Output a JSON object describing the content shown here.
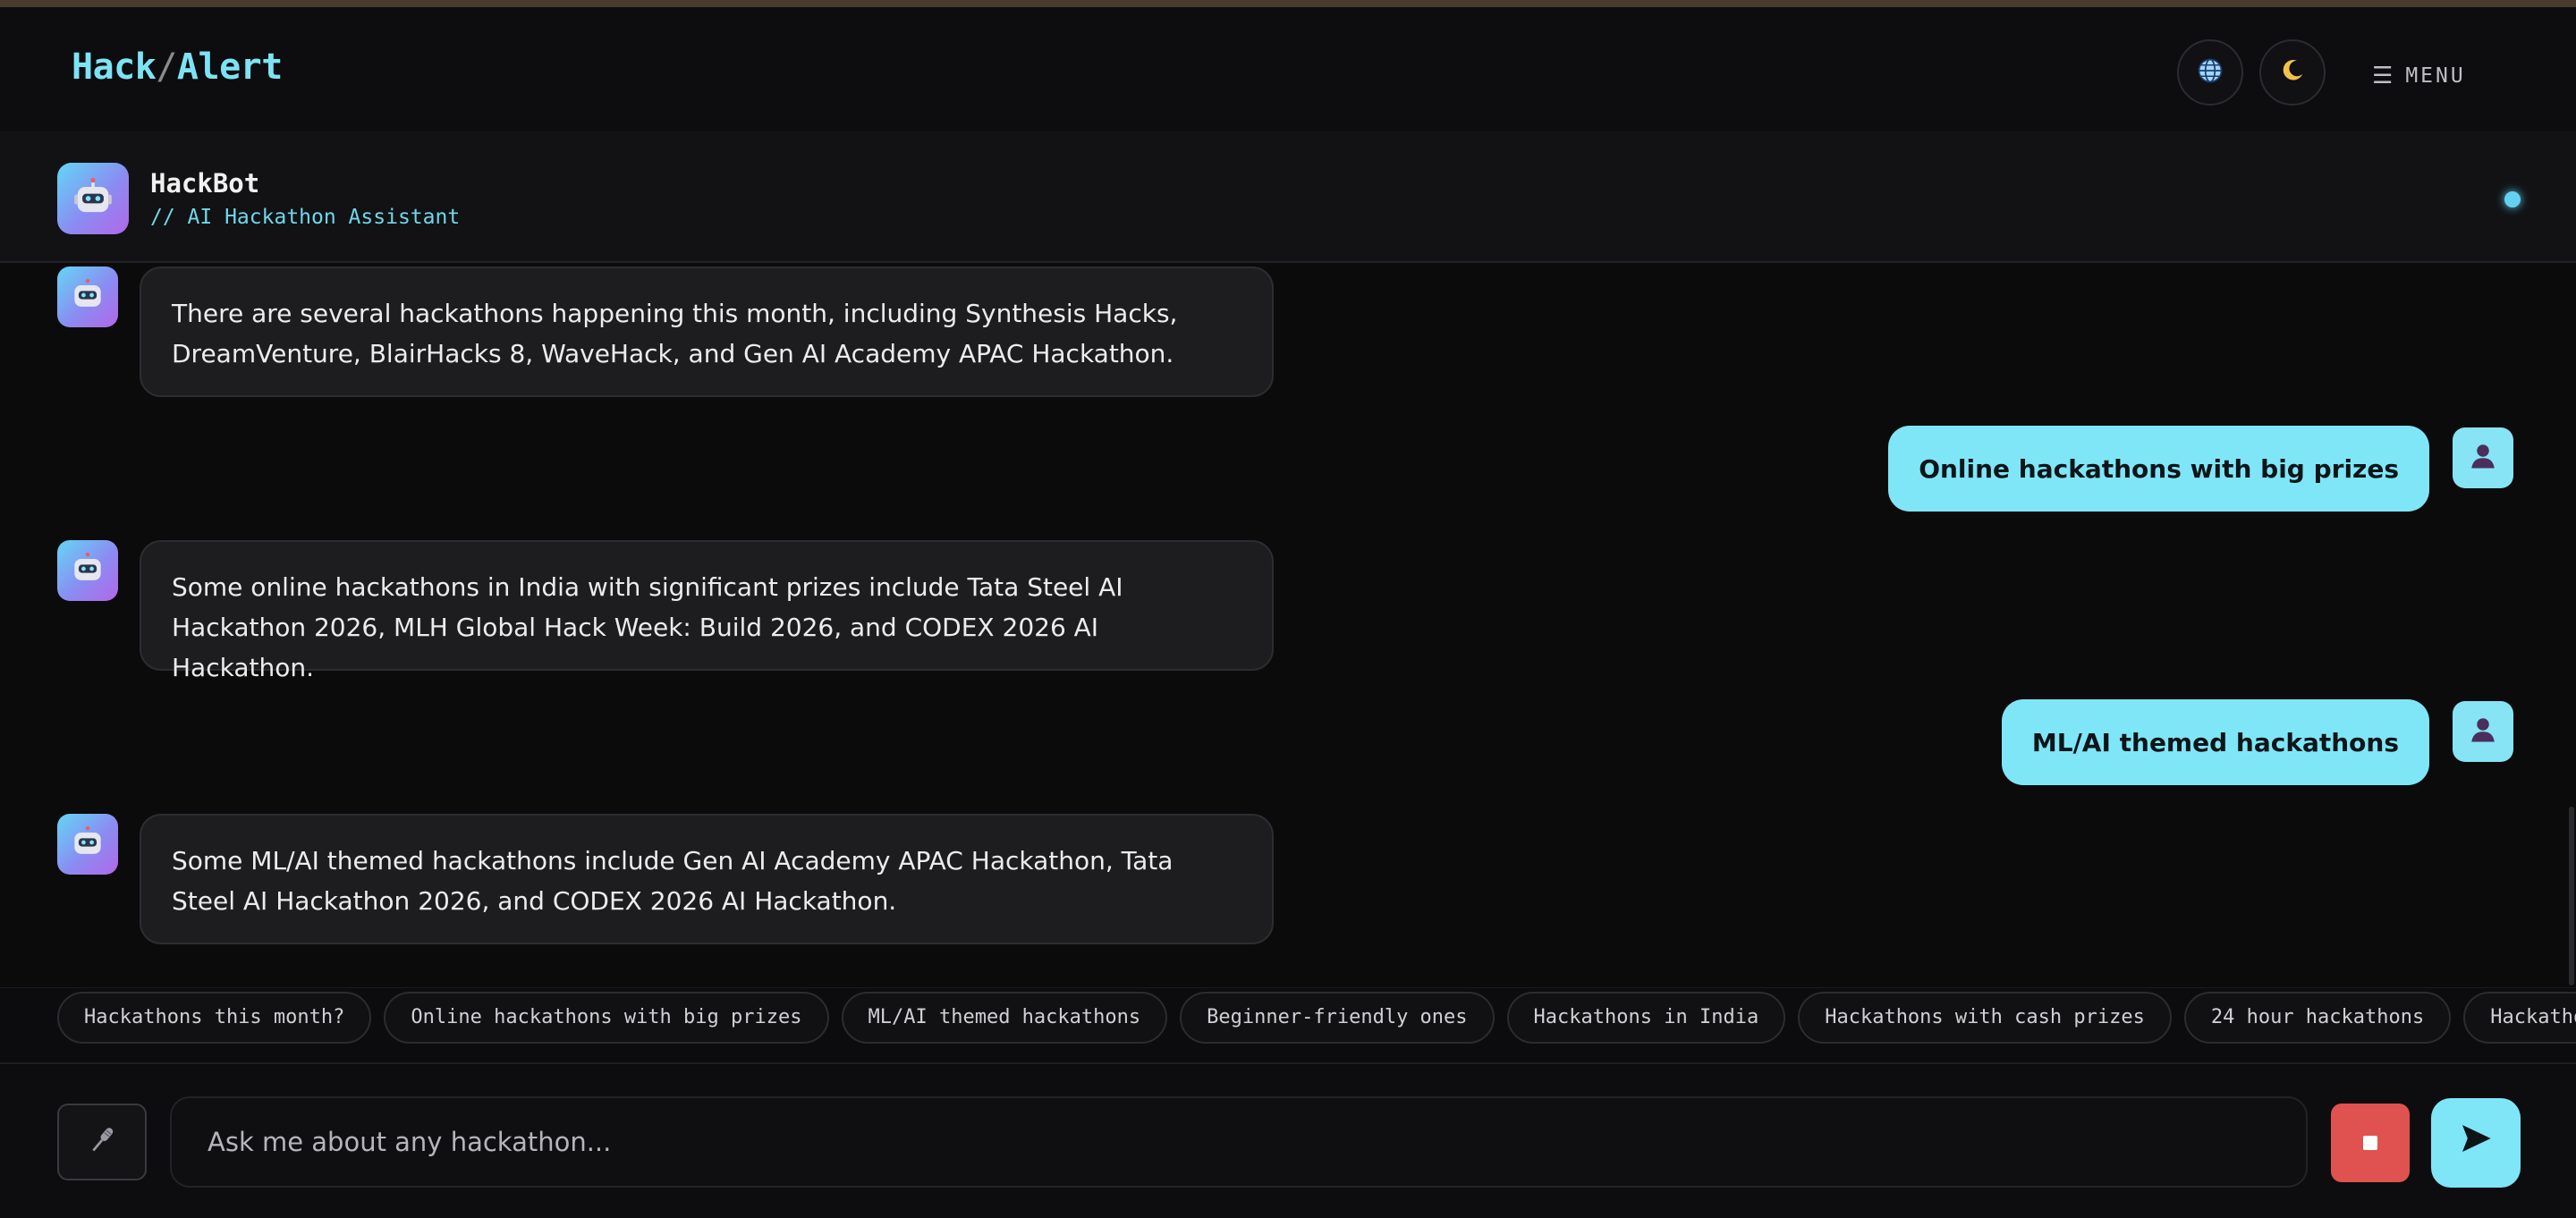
{
  "header": {
    "logo_left": "Hack",
    "logo_sep": "/",
    "logo_right": "Alert",
    "menu_glyph": "☰",
    "menu_label": "MENU",
    "icons": [
      "globe-icon",
      "moon-icon",
      "hamburger-icon"
    ]
  },
  "bot": {
    "name": "HackBot",
    "subtitle": "// AI Hackathon Assistant",
    "status_color": "#63d2f2"
  },
  "messages": [
    {
      "role": "bot",
      "text": "There are several hackathons happening this month, including Synthesis Hacks, DreamVenture, BlairHacks 8, WaveHack, and Gen AI Academy APAC Hackathon."
    },
    {
      "role": "user",
      "text": "Online hackathons with big prizes"
    },
    {
      "role": "bot",
      "text": "Some online hackathons in India with significant prizes include Tata Steel AI Hackathon 2026, MLH Global Hack Week: Build 2026, and CODEX 2026 AI Hackathon."
    },
    {
      "role": "user",
      "text": "ML/AI themed hackathons"
    },
    {
      "role": "bot",
      "text": "Some ML/AI themed hackathons include Gen AI Academy APAC Hackathon, Tata Steel AI Hackathon 2026, and CODEX 2026 AI Hackathon."
    }
  ],
  "suggestions": [
    "Hackathons this month?",
    "Online hackathons with big prizes",
    "ML/AI themed hackathons",
    "Beginner-friendly ones",
    "Hackathons in India",
    "Hackathons with cash prizes",
    "24 hour hackathons",
    "Hackathons for students"
  ],
  "input": {
    "placeholder": "Ask me about any hackathon...",
    "value": ""
  },
  "colors": {
    "accent": "#7fe6f7",
    "stop": "#e0524f",
    "background": "#0b0b0c"
  }
}
